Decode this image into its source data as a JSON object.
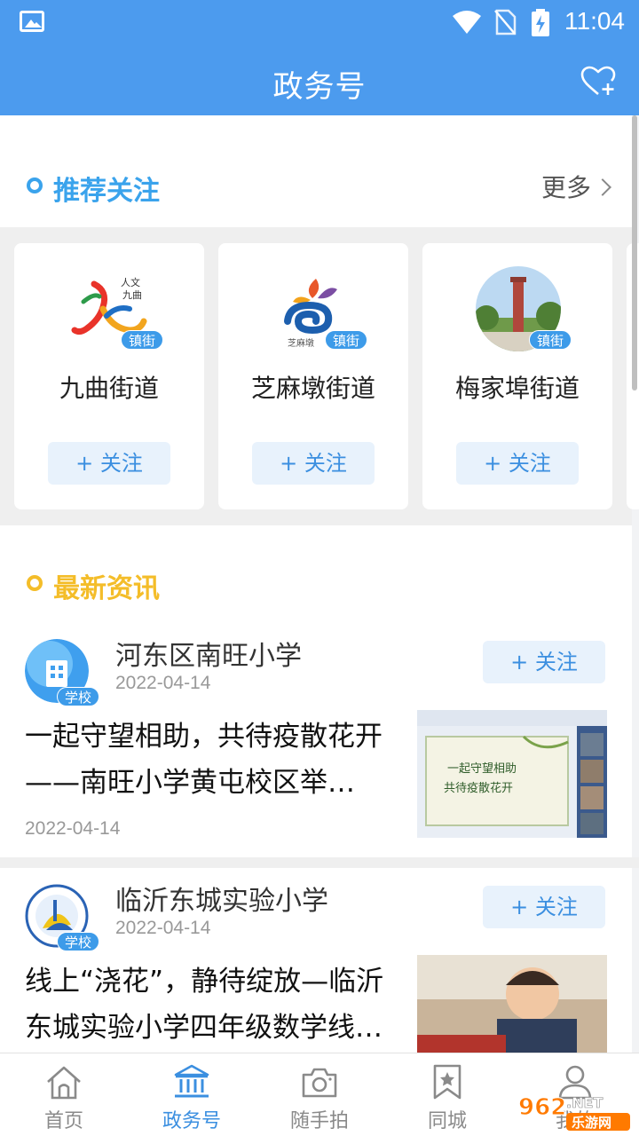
{
  "status_bar": {
    "time": "11:04"
  },
  "header": {
    "title": "政务号"
  },
  "recommend": {
    "title": "推荐关注",
    "more_label": "更多",
    "cards": [
      {
        "name": "九曲街道",
        "badge": "镇街",
        "follow_label": "+ 关注"
      },
      {
        "name": "芝麻墩街道",
        "badge": "镇街",
        "follow_label": "+ 关注"
      },
      {
        "name": "梅家埠街道",
        "badge": "镇街",
        "follow_label": "+ 关注"
      }
    ]
  },
  "news": {
    "title": "最新资讯",
    "items": [
      {
        "source": "河东区南旺小学",
        "badge": "学校",
        "source_date": "2022-04-14",
        "follow_label": "+ 关注",
        "headline": "一起守望相助，共待疫散花开 ——南旺小学黄屯校区举…",
        "date": "2022-04-14"
      },
      {
        "source": "临沂东城实验小学",
        "badge": "学校",
        "source_date": "2022-04-14",
        "follow_label": "+ 关注",
        "headline": "线上“浇花”，静待绽放—临沂东城实验小学四年级数学线…",
        "date": ""
      }
    ]
  },
  "bottom_nav": [
    {
      "label": "首页",
      "icon": "home-icon",
      "active": false
    },
    {
      "label": "政务号",
      "icon": "government-building-icon",
      "active": true
    },
    {
      "label": "随手拍",
      "icon": "camera-icon",
      "active": false
    },
    {
      "label": "同城",
      "icon": "bookmark-star-icon",
      "active": false
    },
    {
      "label": "我的",
      "icon": "user-icon",
      "active": false
    }
  ],
  "watermark": {
    "text1": "962",
    "text2": ".NET",
    "text3": "乐游网"
  },
  "colors": {
    "primary": "#4c9bee",
    "accent_blue": "#3aa3ec",
    "accent_yellow": "#f4bd29"
  }
}
